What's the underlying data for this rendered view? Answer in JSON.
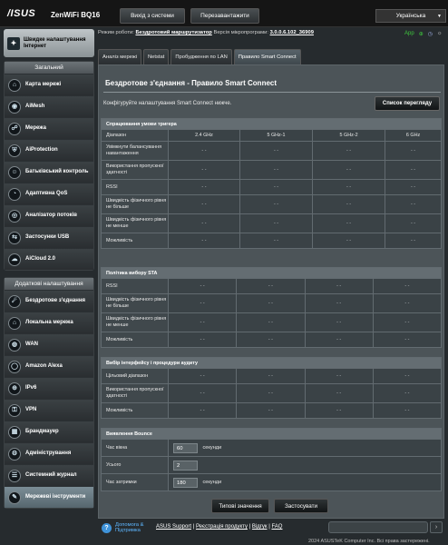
{
  "header": {
    "logo": "/ISUS",
    "model": "ZenWiFi BQ16",
    "logout_label": "Вихід з системи",
    "reboot_label": "Перезавантажити",
    "language": "Українська"
  },
  "status": {
    "mode_label": "Режим роботи:",
    "mode_value": "Бездротовий маршрутизатор",
    "firmware_label": "Версія мікропрограми:",
    "firmware_value": "3.0.0.6.102_36909",
    "icons": [
      "App",
      "globe-icon",
      "clock-icon",
      "settings-icon"
    ]
  },
  "sidebar": {
    "quick_setup": "Швидке налаштування Інтернет",
    "general_title": "Загальний",
    "general_items": [
      {
        "label": "Карта мережі",
        "icon": "⌂"
      },
      {
        "label": "AiMesh",
        "icon": "◉"
      },
      {
        "label": "Мережа",
        "icon": "☍"
      },
      {
        "label": "AiProtection",
        "icon": "⛨"
      },
      {
        "label": "Батьківський контроль",
        "icon": "☺"
      },
      {
        "label": "Адаптивна QoS",
        "icon": "◔"
      },
      {
        "label": "Аналізатор потоків",
        "icon": "◎"
      },
      {
        "label": "Застосунки USB",
        "icon": "⇆"
      },
      {
        "label": "AiCloud 2.0",
        "icon": "☁"
      }
    ],
    "advanced_title": "Додаткові налаштування",
    "advanced_items": [
      {
        "label": "Бездротове з'єднання",
        "icon": "☄"
      },
      {
        "label": "Локальна мережа",
        "icon": "⌂"
      },
      {
        "label": "WAN",
        "icon": "◍"
      },
      {
        "label": "Amazon Alexa",
        "icon": "◯"
      },
      {
        "label": "IPv6",
        "icon": "⊕"
      },
      {
        "label": "VPN",
        "icon": "⚿"
      },
      {
        "label": "Брандмауер",
        "icon": "▦"
      },
      {
        "label": "Адміністрування",
        "icon": "⚙"
      },
      {
        "label": "Системний журнал",
        "icon": "☰"
      },
      {
        "label": "Мережеві інструменти",
        "icon": "✎"
      }
    ]
  },
  "tabs": [
    "Аналіз мережі",
    "Netstat",
    "Пробудження по LAN",
    "Правило Smart Connect"
  ],
  "page": {
    "title": "Бездротове з'єднання - Правило Smart Connect",
    "description": "Конфігуруйте налаштування Smart Connect нижче.",
    "list_button": "Список перегляду"
  },
  "trigger_section": {
    "title": "Спрацювання умови тригера",
    "band_label": "Діапазон",
    "bands": [
      "2.4 GHz",
      "5 GHz-1",
      "5 GHz-2",
      "6 GHz"
    ],
    "rows": [
      "Увімкнути балансування навантаження",
      "Використання пропускної здатності",
      "RSSI",
      "Швидкість фізичного рівня не більше",
      "Швидкість фізичного рівня не менше",
      "Можливість"
    ],
    "empty_value": "- -"
  },
  "sta_section": {
    "title": "Політика вибору STA",
    "rows": [
      "RSSI",
      "Швидкість фізичного рівня не більше",
      "Швидкість фізичного рівня не менше",
      "Можливість"
    ],
    "empty_value": "- -"
  },
  "audit_section": {
    "title": "Вибір інтерфейсу і процедури аудиту",
    "rows": [
      "Цільовий діапазон",
      "Використання пропускної здатності",
      "Можливість"
    ],
    "empty_value": "- -"
  },
  "bounce_section": {
    "title": "Виявлення Bounce",
    "window_label": "Час вікна",
    "window_value": "60",
    "window_unit": "секунди",
    "count_label": "Усього",
    "count_value": "2",
    "dwell_label": "Час затримки",
    "dwell_value": "180",
    "dwell_unit": "секунди"
  },
  "actions": {
    "default_label": "Типові значення",
    "apply_label": "Застосувати"
  },
  "footer": {
    "help_label": "Допомога & Підтримка",
    "support": "ASUS Support",
    "registration": "Реєстрація продукту",
    "feedback": "Відгук",
    "faq": "FAQ",
    "copyright": "2024 ASUSTeK Computer Inc. Всі права застережені."
  }
}
